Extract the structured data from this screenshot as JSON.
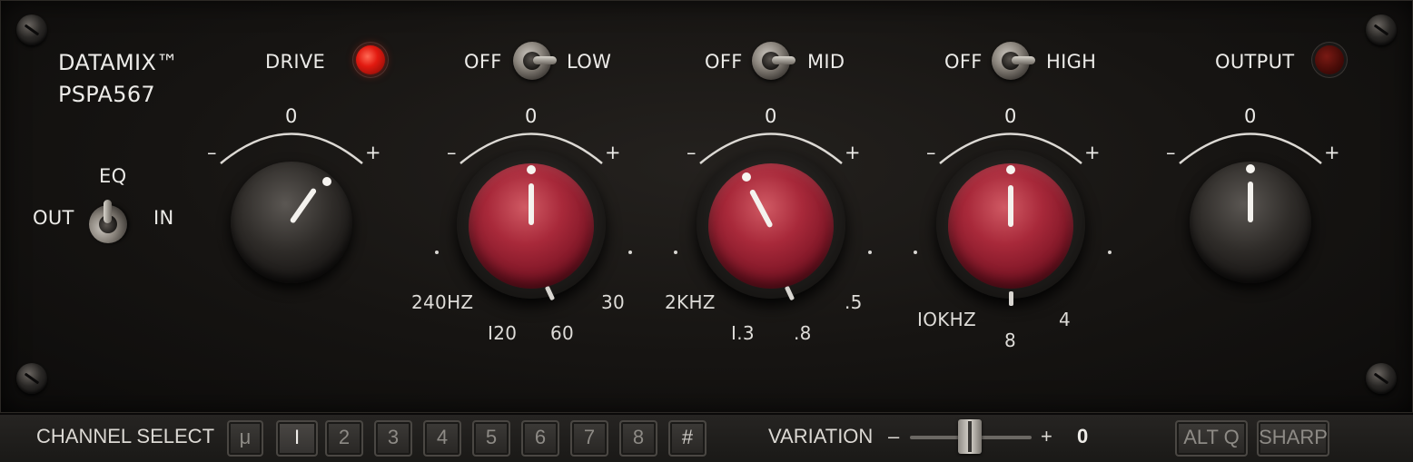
{
  "brand": {
    "line1": "DATAMIX™",
    "line2": "PSPA567"
  },
  "drive": {
    "label": "DRIVE",
    "led": "on"
  },
  "eq_switch": {
    "title": "EQ",
    "left": "OUT",
    "right": "IN"
  },
  "bands": [
    {
      "off": "OFF",
      "name": "LOW",
      "freqs": [
        "240HZ",
        "I20",
        "60",
        "30"
      ]
    },
    {
      "off": "OFF",
      "name": "MID",
      "freqs": [
        "2KHZ",
        "I.3",
        ".8",
        ".5"
      ]
    },
    {
      "off": "OFF",
      "name": "HIGH",
      "freqs": [
        "IOKHZ",
        "8",
        "4"
      ]
    }
  ],
  "output": {
    "label": "OUTPUT",
    "led": "off"
  },
  "scale": {
    "zero": "0",
    "minus": "–",
    "plus": "+"
  },
  "bottom": {
    "channel_select": "CHANNEL SELECT",
    "mu": "μ",
    "channels": [
      "I",
      "2",
      "3",
      "4",
      "5",
      "6",
      "7",
      "8"
    ],
    "selected_channel": "I",
    "hash": "#",
    "variation_label": "VARIATION",
    "variation_minus": "–",
    "variation_plus": "+",
    "variation_value": "0",
    "alt_q": "ALT Q",
    "sharp": "SHARP"
  },
  "colors": {
    "led_on": "#e21a10",
    "knob_red": "#a8293a"
  }
}
